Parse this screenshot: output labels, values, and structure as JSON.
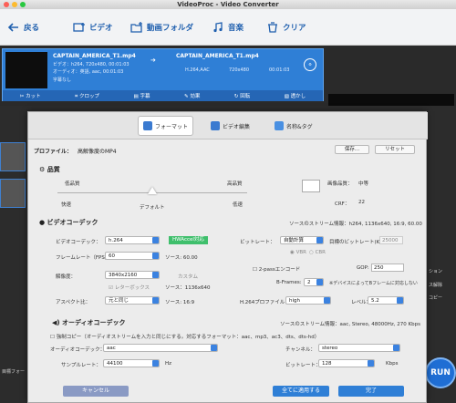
{
  "window": {
    "title": "VideoProc - Video Converter"
  },
  "toolbar": {
    "back": "戻る",
    "video": "ビデオ",
    "folder": "動画フォルダ",
    "music": "音楽",
    "clear": "クリア"
  },
  "file": {
    "name": "CAPTAIN_AMERICA_T1.mp4",
    "video_info": "ビデオ：h264, 720x480, 00:01:03",
    "audio_info": "オーディオ：英語, aac, 00:01:03",
    "subtitle": "字幕なし",
    "out_name": "CAPTAIN_AMERICA_T1.mp4",
    "out_codec": "H.264,AAC",
    "out_res": "720x480",
    "out_dur": "00:01:03"
  },
  "edit": {
    "cut": "カット",
    "crop": "クロップ",
    "subtitle": "字幕",
    "effect": "効果",
    "rotate": "回転",
    "watermark": "透かし"
  },
  "side": {
    "target": "目標フォー",
    "option": "ション",
    "remove": "ス解除",
    "copy": "コピー",
    "run": "RUN"
  },
  "dialog": {
    "tabs": {
      "format": "フォーマット",
      "video_edit": "ビデオ編集",
      "name_tag": "名称&タグ"
    },
    "profile_label": "プロファイル：",
    "profile_value": "高解像度のMP4",
    "save": "保存...",
    "reset": "リセット",
    "quality": {
      "title": "品質",
      "low": "低品質",
      "high": "高品質",
      "fast": "快速",
      "default": "デフォルト",
      "slow": "低速",
      "image_quality_label": "画像品質：",
      "image_quality": "中等",
      "crf_label": "CRF：",
      "crf": "22"
    },
    "video": {
      "title": "ビデオコーデック",
      "stream_info": "ソースのストリーム情報：h264, 1136x640, 16:9, 60.00",
      "codec_label": "ビデオコーデック：",
      "codec": "h.264",
      "hwaccel": "HWAccel対応",
      "fps_label": "フレームレート（FPS）：",
      "fps": "60",
      "fps_source": "ソース: 60.00",
      "res_label": "解像度：",
      "res": "3840x2160",
      "custom": "カスタム",
      "letterbox": "レターボックス",
      "res_source": "ソース：1136x640",
      "aspect_label": "アスペクト比：",
      "aspect": "元と同じ",
      "aspect_source": "ソース: 16:9",
      "bitrate_label": "ビットレート：",
      "bitrate": "自動計算",
      "target_bitrate": "目標のビットレート(Kb",
      "target_bitrate_val": "25000",
      "vbr": "VBR",
      "cbr": "CBR",
      "two_pass": "2-passエンコード",
      "gop_label": "GOP:",
      "gop": "250",
      "bframes_label": "B-Frames:",
      "bframes": "2",
      "bframes_note": "※デバイスによってBフレームに対応しない",
      "profile_label": "H.264プロファイル：",
      "profile": "high",
      "level_label": "レベル：",
      "level": "5.2"
    },
    "audio": {
      "title": "オーディオコーデック",
      "stream_info": "ソースのストリーム情報：aac, Stereo, 48000Hz, 270 Kbps",
      "force_copy": "強制コピー（オーディオストリームを入力と同じにする。対応するフォーマット：aac、mp3、ac3、dts、dts-hd）",
      "codec_label": "オーディオコーデック：",
      "codec": "aac",
      "channel_label": "チャンネル：",
      "channel": "stereo",
      "sample_label": "サンプルレート：",
      "sample": "44100",
      "sample_unit": "Hz",
      "bitrate_label": "ビットレート：",
      "bitrate": "128",
      "bitrate_unit": "Kbps"
    },
    "buttons": {
      "cancel": "キャンセル",
      "apply_all": "全てに適用する",
      "done": "完了"
    }
  }
}
